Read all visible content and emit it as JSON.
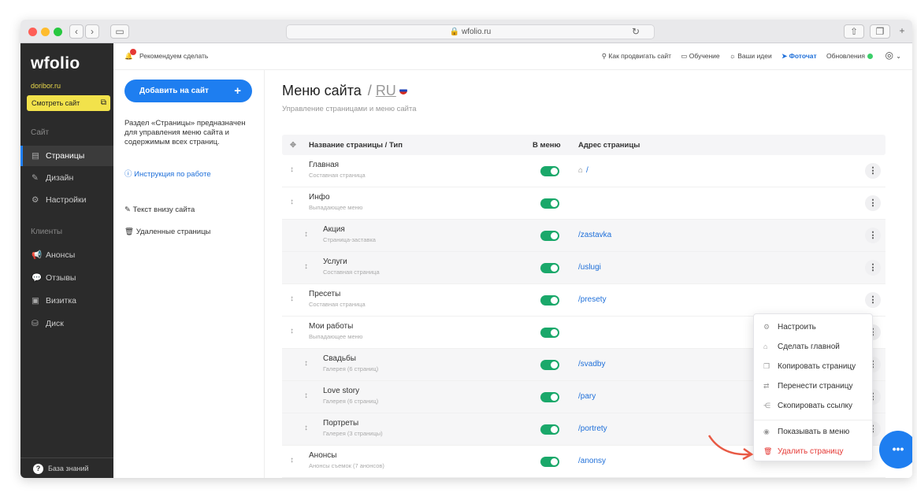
{
  "browser": {
    "url": "wfolio.ru"
  },
  "sidebar": {
    "logo": "wfolio",
    "domain": "doribor.ru",
    "view_site": "Смотреть сайт",
    "section_site": "Сайт",
    "items_site": [
      {
        "label": "Страницы",
        "icon": "page-icon",
        "active": true
      },
      {
        "label": "Дизайн",
        "icon": "brush-icon"
      },
      {
        "label": "Настройки",
        "icon": "gear-icon"
      }
    ],
    "section_clients": "Клиенты",
    "items_clients": [
      {
        "label": "Анонсы",
        "icon": "megaphone-icon"
      },
      {
        "label": "Отзывы",
        "icon": "chat-bubble-icon"
      },
      {
        "label": "Визитка",
        "icon": "card-icon"
      },
      {
        "label": "Диск",
        "icon": "disk-icon"
      }
    ],
    "knowledge": "База знаний"
  },
  "topbar": {
    "recommend": "Рекомендуем сделать",
    "links": [
      "Как продвигать сайт",
      "Обучение",
      "Ваши идеи",
      "Фоточат",
      "Обновления"
    ]
  },
  "left": {
    "add_button": "Добавить на сайт",
    "description": "Раздел «Страницы» предназначен для управления меню сайта и содержимым всех страниц.",
    "instructions": "Инструкция по работе",
    "footer_text": "Текст внизу сайта",
    "deleted_pages": "Удаленные страницы"
  },
  "main": {
    "title": "Меню сайта",
    "lang_sep": "/",
    "lang": "RU",
    "subtitle": "Управление страницами и меню сайта",
    "columns": {
      "name": "Название страницы / Тип",
      "in_menu": "В меню",
      "address": "Адрес страницы"
    },
    "rows": [
      {
        "name": "Главная",
        "type": "Составная страница",
        "address": "/",
        "home": true,
        "child": false
      },
      {
        "name": "Инфо",
        "type": "Выпадающее меню",
        "address": "",
        "child": false
      },
      {
        "name": "Акция",
        "type": "Страница-заставка",
        "address": "/zastavka",
        "child": true
      },
      {
        "name": "Услуги",
        "type": "Составная страница",
        "address": "/uslugi",
        "child": true
      },
      {
        "name": "Пресеты",
        "type": "Составная страница",
        "address": "/presety",
        "child": false
      },
      {
        "name": "Мои работы",
        "type": "Выпадающее меню",
        "address": "",
        "child": false
      },
      {
        "name": "Свадьбы",
        "type": "Галерея (6 страниц)",
        "address": "/svadby",
        "child": true
      },
      {
        "name": "Love story",
        "type": "Галерея (6 страниц)",
        "address": "/pary",
        "child": true
      },
      {
        "name": "Портреты",
        "type": "Галерея (3 страницы)",
        "address": "/portrety",
        "child": true
      },
      {
        "name": "Анонсы",
        "type": "Анонсы съемок (7 анонсов)",
        "address": "/anonsy",
        "child": false
      }
    ]
  },
  "context_menu": [
    {
      "label": "Настроить",
      "icon": "settings-icon"
    },
    {
      "label": "Сделать главной",
      "icon": "home-icon"
    },
    {
      "label": "Копировать страницу",
      "icon": "copy-icon"
    },
    {
      "label": "Перенести страницу",
      "icon": "move-icon"
    },
    {
      "label": "Скопировать ссылку",
      "icon": "share-icon"
    },
    {
      "label": "Показывать в меню",
      "icon": "eye-icon"
    },
    {
      "label": "Удалить страницу",
      "icon": "trash-icon",
      "danger": true
    }
  ],
  "colors": {
    "accent": "#1e7ef0",
    "toggle": "#1aa86a",
    "sidebar": "#2b2b2b",
    "highlight": "#f2e24b",
    "danger": "#e53935"
  }
}
